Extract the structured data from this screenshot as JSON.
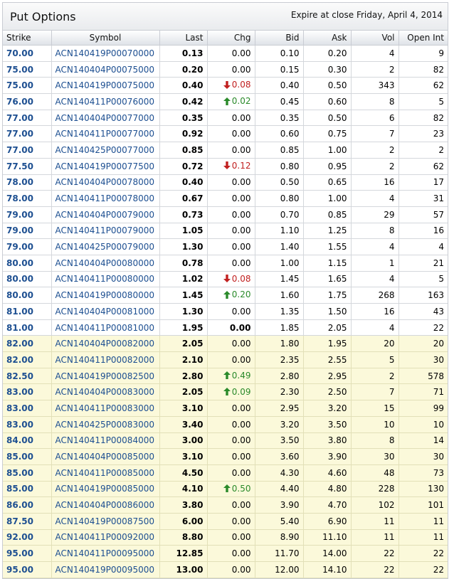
{
  "header": {
    "title": "Put Options",
    "expire_note": "Expire at close Friday, April 4, 2014"
  },
  "colors": {
    "itm_row": "#fbf9da",
    "link": "#1d4f91",
    "up": "#2a8a2a",
    "down": "#c12020"
  },
  "columns": [
    "Strike",
    "Symbol",
    "Last",
    "Chg",
    "Bid",
    "Ask",
    "Vol",
    "Open Int"
  ],
  "rows": [
    {
      "strike": "70.00",
      "symbol": "ACN140419P00070000",
      "last": "0.13",
      "chg": "0.00",
      "dir": "",
      "bid": "0.10",
      "ask": "0.20",
      "vol": "4",
      "oi": "9",
      "itm": false
    },
    {
      "strike": "75.00",
      "symbol": "ACN140404P00075000",
      "last": "0.20",
      "chg": "0.00",
      "dir": "",
      "bid": "0.15",
      "ask": "0.30",
      "vol": "2",
      "oi": "82",
      "itm": false
    },
    {
      "strike": "75.00",
      "symbol": "ACN140419P00075000",
      "last": "0.40",
      "chg": "0.08",
      "dir": "down",
      "bid": "0.40",
      "ask": "0.50",
      "vol": "343",
      "oi": "62",
      "itm": false
    },
    {
      "strike": "76.00",
      "symbol": "ACN140411P00076000",
      "last": "0.42",
      "chg": "0.02",
      "dir": "up",
      "bid": "0.45",
      "ask": "0.60",
      "vol": "8",
      "oi": "5",
      "itm": false
    },
    {
      "strike": "77.00",
      "symbol": "ACN140404P00077000",
      "last": "0.35",
      "chg": "0.00",
      "dir": "",
      "bid": "0.35",
      "ask": "0.50",
      "vol": "6",
      "oi": "82",
      "itm": false
    },
    {
      "strike": "77.00",
      "symbol": "ACN140411P00077000",
      "last": "0.92",
      "chg": "0.00",
      "dir": "",
      "bid": "0.60",
      "ask": "0.75",
      "vol": "7",
      "oi": "23",
      "itm": false
    },
    {
      "strike": "77.00",
      "symbol": "ACN140425P00077000",
      "last": "0.85",
      "chg": "0.00",
      "dir": "",
      "bid": "0.85",
      "ask": "1.00",
      "vol": "2",
      "oi": "2",
      "itm": false
    },
    {
      "strike": "77.50",
      "symbol": "ACN140419P00077500",
      "last": "0.72",
      "chg": "0.12",
      "dir": "down",
      "bid": "0.80",
      "ask": "0.95",
      "vol": "2",
      "oi": "62",
      "itm": false
    },
    {
      "strike": "78.00",
      "symbol": "ACN140404P00078000",
      "last": "0.40",
      "chg": "0.00",
      "dir": "",
      "bid": "0.50",
      "ask": "0.65",
      "vol": "16",
      "oi": "17",
      "itm": false
    },
    {
      "strike": "78.00",
      "symbol": "ACN140411P00078000",
      "last": "0.67",
      "chg": "0.00",
      "dir": "",
      "bid": "0.80",
      "ask": "1.00",
      "vol": "4",
      "oi": "31",
      "itm": false
    },
    {
      "strike": "79.00",
      "symbol": "ACN140404P00079000",
      "last": "0.73",
      "chg": "0.00",
      "dir": "",
      "bid": "0.70",
      "ask": "0.85",
      "vol": "29",
      "oi": "57",
      "itm": false
    },
    {
      "strike": "79.00",
      "symbol": "ACN140411P00079000",
      "last": "1.05",
      "chg": "0.00",
      "dir": "",
      "bid": "1.10",
      "ask": "1.25",
      "vol": "8",
      "oi": "16",
      "itm": false
    },
    {
      "strike": "79.00",
      "symbol": "ACN140425P00079000",
      "last": "1.30",
      "chg": "0.00",
      "dir": "",
      "bid": "1.40",
      "ask": "1.55",
      "vol": "4",
      "oi": "4",
      "itm": false
    },
    {
      "strike": "80.00",
      "symbol": "ACN140404P00080000",
      "last": "0.78",
      "chg": "0.00",
      "dir": "",
      "bid": "1.00",
      "ask": "1.15",
      "vol": "1",
      "oi": "21",
      "itm": false
    },
    {
      "strike": "80.00",
      "symbol": "ACN140411P00080000",
      "last": "1.02",
      "chg": "0.08",
      "dir": "down",
      "bid": "1.45",
      "ask": "1.65",
      "vol": "4",
      "oi": "5",
      "itm": false
    },
    {
      "strike": "80.00",
      "symbol": "ACN140419P00080000",
      "last": "1.45",
      "chg": "0.20",
      "dir": "up",
      "bid": "1.60",
      "ask": "1.75",
      "vol": "268",
      "oi": "163",
      "itm": false
    },
    {
      "strike": "81.00",
      "symbol": "ACN140404P00081000",
      "last": "1.30",
      "chg": "0.00",
      "dir": "",
      "bid": "1.35",
      "ask": "1.50",
      "vol": "16",
      "oi": "43",
      "itm": false
    },
    {
      "strike": "81.00",
      "symbol": "ACN140411P00081000",
      "last": "1.95",
      "chg": "0.00",
      "dir": "",
      "bid": "1.85",
      "ask": "2.05",
      "vol": "4",
      "oi": "22",
      "itm": false,
      "chg_bold": true
    },
    {
      "strike": "82.00",
      "symbol": "ACN140404P00082000",
      "last": "2.05",
      "chg": "0.00",
      "dir": "",
      "bid": "1.80",
      "ask": "1.95",
      "vol": "20",
      "oi": "20",
      "itm": true
    },
    {
      "strike": "82.00",
      "symbol": "ACN140411P00082000",
      "last": "2.10",
      "chg": "0.00",
      "dir": "",
      "bid": "2.35",
      "ask": "2.55",
      "vol": "5",
      "oi": "30",
      "itm": true
    },
    {
      "strike": "82.50",
      "symbol": "ACN140419P00082500",
      "last": "2.80",
      "chg": "0.49",
      "dir": "up",
      "bid": "2.80",
      "ask": "2.95",
      "vol": "2",
      "oi": "578",
      "itm": true
    },
    {
      "strike": "83.00",
      "symbol": "ACN140404P00083000",
      "last": "2.05",
      "chg": "0.09",
      "dir": "up",
      "bid": "2.30",
      "ask": "2.50",
      "vol": "7",
      "oi": "71",
      "itm": true
    },
    {
      "strike": "83.00",
      "symbol": "ACN140411P00083000",
      "last": "3.10",
      "chg": "0.00",
      "dir": "",
      "bid": "2.95",
      "ask": "3.20",
      "vol": "15",
      "oi": "99",
      "itm": true
    },
    {
      "strike": "83.00",
      "symbol": "ACN140425P00083000",
      "last": "3.40",
      "chg": "0.00",
      "dir": "",
      "bid": "3.20",
      "ask": "3.50",
      "vol": "10",
      "oi": "10",
      "itm": true
    },
    {
      "strike": "84.00",
      "symbol": "ACN140411P00084000",
      "last": "3.00",
      "chg": "0.00",
      "dir": "",
      "bid": "3.50",
      "ask": "3.80",
      "vol": "8",
      "oi": "14",
      "itm": true
    },
    {
      "strike": "85.00",
      "symbol": "ACN140404P00085000",
      "last": "3.10",
      "chg": "0.00",
      "dir": "",
      "bid": "3.60",
      "ask": "3.90",
      "vol": "30",
      "oi": "30",
      "itm": true
    },
    {
      "strike": "85.00",
      "symbol": "ACN140411P00085000",
      "last": "4.50",
      "chg": "0.00",
      "dir": "",
      "bid": "4.30",
      "ask": "4.60",
      "vol": "48",
      "oi": "73",
      "itm": true
    },
    {
      "strike": "85.00",
      "symbol": "ACN140419P00085000",
      "last": "4.10",
      "chg": "0.50",
      "dir": "up",
      "bid": "4.40",
      "ask": "4.80",
      "vol": "228",
      "oi": "130",
      "itm": true
    },
    {
      "strike": "86.00",
      "symbol": "ACN140404P00086000",
      "last": "3.80",
      "chg": "0.00",
      "dir": "",
      "bid": "3.90",
      "ask": "4.70",
      "vol": "102",
      "oi": "101",
      "itm": true
    },
    {
      "strike": "87.50",
      "symbol": "ACN140419P00087500",
      "last": "6.00",
      "chg": "0.00",
      "dir": "",
      "bid": "5.40",
      "ask": "6.90",
      "vol": "11",
      "oi": "11",
      "itm": true
    },
    {
      "strike": "92.00",
      "symbol": "ACN140411P00092000",
      "last": "8.80",
      "chg": "0.00",
      "dir": "",
      "bid": "8.90",
      "ask": "11.10",
      "vol": "11",
      "oi": "11",
      "itm": true
    },
    {
      "strike": "95.00",
      "symbol": "ACN140411P00095000",
      "last": "12.85",
      "chg": "0.00",
      "dir": "",
      "bid": "11.70",
      "ask": "14.00",
      "vol": "22",
      "oi": "22",
      "itm": true
    },
    {
      "strike": "95.00",
      "symbol": "ACN140419P00095000",
      "last": "13.00",
      "chg": "0.00",
      "dir": "",
      "bid": "12.00",
      "ask": "14.10",
      "vol": "22",
      "oi": "22",
      "itm": true
    }
  ]
}
